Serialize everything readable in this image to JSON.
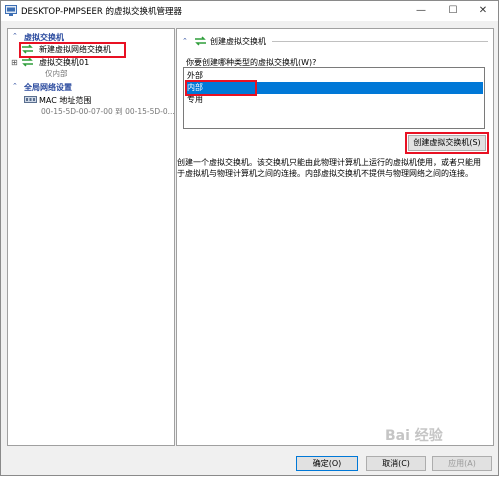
{
  "window": {
    "title": "DESKTOP-PMPSEER 的虚拟交换机管理器",
    "min_glyph": "—",
    "max_glyph": "☐",
    "close_glyph": "✕"
  },
  "left": {
    "section_switches": "虚拟交换机",
    "new_switch": "新建虚拟网络交换机",
    "switch1_name": "虚拟交换机01",
    "switch1_type": "仅内部",
    "section_global": "全局网络设置",
    "mac_label": "MAC 地址范围",
    "mac_range": "00-15-5D-00-07-00 到 00-15-5D-0..."
  },
  "right": {
    "header": "创建虚拟交换机",
    "question": "你要创建哪种类型的虚拟交换机(W)?",
    "types": [
      "外部",
      "内部",
      "专用"
    ],
    "selected_index": 1,
    "create_button": "创建虚拟交换机(S)",
    "description": "创建一个虚拟交换机。该交换机只能由此物理计算机上运行的虚拟机使用，或者只能用于虚拟机与物理计算机之间的连接。内部虚拟交换机不提供与物理网络之间的连接。"
  },
  "footer": {
    "ok": "确定(O)",
    "cancel": "取消(C)",
    "apply": "应用(A)"
  },
  "watermark": "Bai 经验"
}
